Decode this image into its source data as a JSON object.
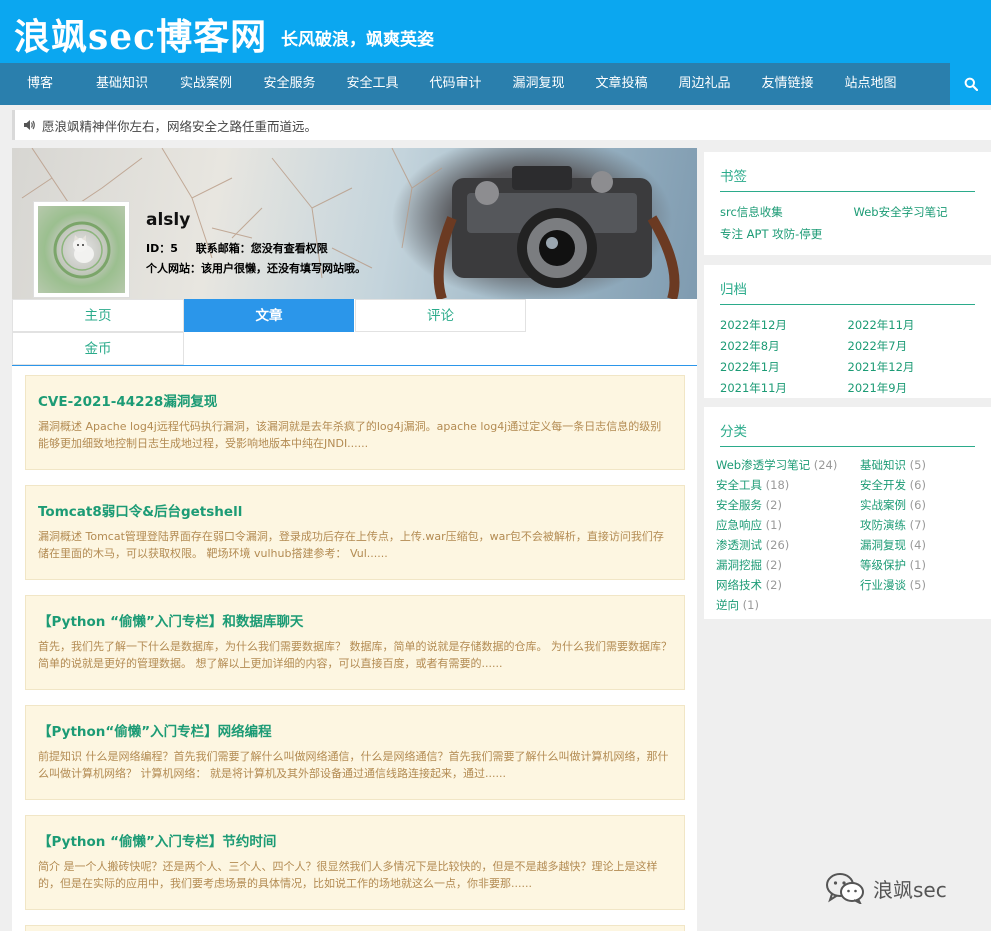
{
  "header": {
    "title": "浪飒sec博客网",
    "subtitle": "长风破浪，飒爽英姿"
  },
  "nav": {
    "items": [
      "博客",
      "基础知识",
      "实战案例",
      "安全服务",
      "安全工具",
      "代码审计",
      "漏洞复现",
      "文章投稿",
      "周边礼品",
      "友情链接",
      "站点地图"
    ],
    "search_icon": "search-icon"
  },
  "notice": {
    "icon": "speaker-icon",
    "text": "愿浪飒精神伴你左右，网络安全之路任重而道远。"
  },
  "profile": {
    "name": "alsly",
    "id_label": "ID：",
    "id_value": "5",
    "email_label": "联系邮箱：",
    "email_value": "您没有查看权限",
    "site_label": "个人网站：",
    "site_value": "该用户很懒，还没有填写网站哦。"
  },
  "tabs": [
    {
      "label": "主页"
    },
    {
      "label": "文章"
    },
    {
      "label": "评论"
    },
    {
      "label": "金币"
    }
  ],
  "posts": [
    {
      "title": "CVE-2021-44228漏洞复现",
      "excerpt": "漏洞概述 Apache log4j远程代码执行漏洞，该漏洞就是去年杀疯了的log4j漏洞。apache log4j通过定义每一条日志信息的级别能够更加细致地控制日志生成地过程，受影响地版本中纯在JNDI......"
    },
    {
      "title": "Tomcat8弱口令&后台getshell",
      "excerpt": "漏洞概述 Tomcat管理登陆界面存在弱口令漏洞，登录成功后存在上传点，上传.war压缩包，war包不会被解析，直接访问我们存储在里面的木马，可以获取权限。 靶场环境 vulhub搭建参考： Vul......"
    },
    {
      "title": "【Python “偷懒”入门专栏】和数据库聊天",
      "excerpt": "首先，我们先了解一下什么是数据库，为什么我们需要数据库？ 数据库，简单的说就是存储数据的仓库。 为什么我们需要数据库？简单的说就是更好的管理数据。 想了解以上更加详细的内容，可以直接百度，或者有需要的......"
    },
    {
      "title": "【Python“偷懒”入门专栏】网络编程",
      "excerpt": "前提知识 什么是网络编程？首先我们需要了解什么叫做网络通信，什么是网络通信？首先我们需要了解什么叫做计算机网络，那什么叫做计算机网络？ 计算机网络： 就是将计算机及其外部设备通过通信线路连接起来，通过......"
    },
    {
      "title": "【Python “偷懒”入门专栏】节约时间",
      "excerpt": "简介 是一个人搬砖快呢？还是两个人、三个人、四个人？很显然我们人多情况下是比较快的，但是不是越多越快？理论上是这样的，但是在实际的应用中，我们要考虑场景的具体情况，比如说工作的场地就这么一点，你非要那......"
    }
  ],
  "sidebar": {
    "bookmarks": {
      "title": "书签",
      "links": [
        "src信息收集",
        "Web安全学习笔记",
        "专注 APT 攻防-停更"
      ]
    },
    "archive": {
      "title": "归档",
      "links": [
        "2022年12月",
        "2022年11月",
        "2022年8月",
        "2022年7月",
        "2022年1月",
        "2021年12月",
        "2021年11月",
        "2021年9月"
      ]
    },
    "categories": {
      "title": "分类",
      "items": [
        {
          "name": "Web渗透学习笔记",
          "count": "(24)"
        },
        {
          "name": "基础知识",
          "count": "(5)"
        },
        {
          "name": "安全工具",
          "count": "(18)"
        },
        {
          "name": "安全开发",
          "count": "(6)"
        },
        {
          "name": "安全服务",
          "count": "(2)"
        },
        {
          "name": "实战案例",
          "count": "(6)"
        },
        {
          "name": "应急响应",
          "count": "(1)"
        },
        {
          "name": "攻防演练",
          "count": "(7)"
        },
        {
          "name": "渗透测试",
          "count": "(26)"
        },
        {
          "name": "漏洞复现",
          "count": "(4)"
        },
        {
          "name": "漏洞挖掘",
          "count": "(2)"
        },
        {
          "name": "等级保护",
          "count": "(1)"
        },
        {
          "name": "网络技术",
          "count": "(2)"
        },
        {
          "name": "行业漫谈",
          "count": "(5)"
        },
        {
          "name": "逆向",
          "count": "(1)"
        }
      ]
    }
  },
  "watermark": {
    "icon": "wechat-icon",
    "text": "浪飒sec"
  },
  "colors": {
    "header_bg": "#0ba7f0",
    "nav_bg": "#2a7fad",
    "accent": "#2b96ea",
    "link_green": "#1c9b75",
    "post_bg": "#fdf6e1",
    "excerpt": "#b38b52"
  }
}
